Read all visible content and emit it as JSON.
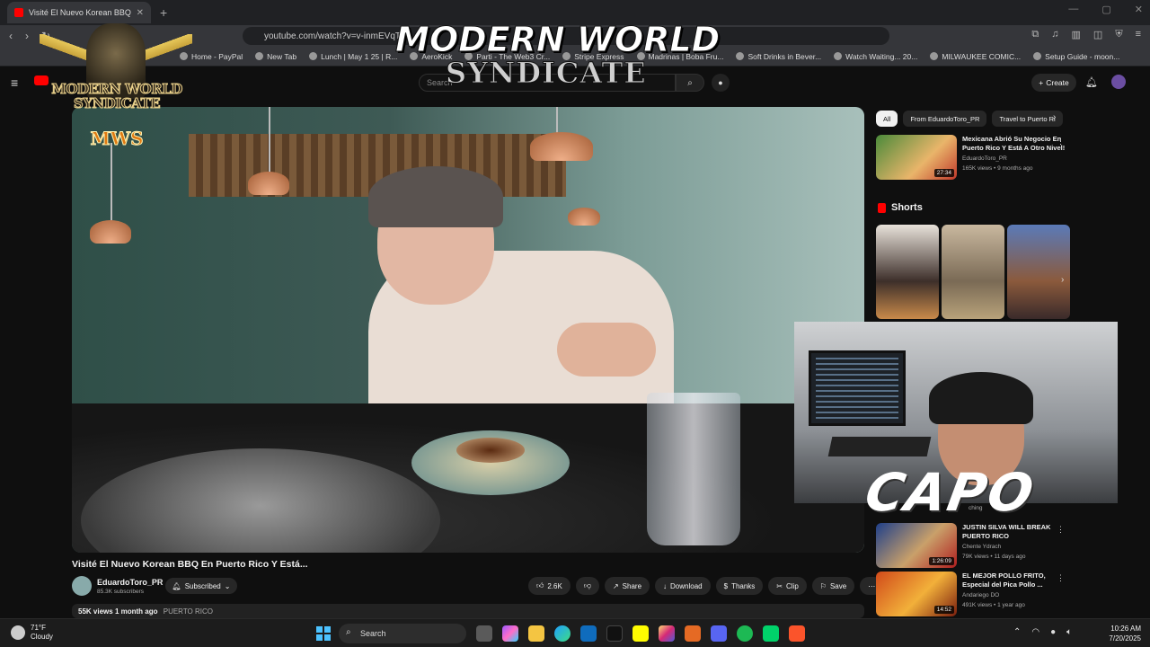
{
  "browser": {
    "tab_title": "Visité El Nuevo Korean BBQ En",
    "url": "youtube.com/watch?v=v-inmEVqTLA",
    "bookmarks": [
      "Home - PayPal",
      "New Tab",
      "Lunch | May 1 25 | R...",
      "AeroKick",
      "Parti - The Web3 Cr...",
      "Stripe Express",
      "Madrinas | Boba Fru...",
      "Soft Drinks in Bever...",
      "Watch Waiting... 20...",
      "MILWAUKEE COMIC...",
      "Setup Guide - moon..."
    ]
  },
  "youtube": {
    "search_placeholder": "Search",
    "create_label": "Create",
    "video": {
      "title": "Visité El Nuevo Korean BBQ En Puerto Rico Y Está...",
      "channel": "EduardoToro_PR",
      "subscribers": "85.3K subscribers",
      "subscribe_label": "Subscribed",
      "likes": "2.6K",
      "share_label": "Share",
      "download_label": "Download",
      "thanks_label": "Thanks",
      "clip_label": "Clip",
      "save_label": "Save",
      "views": "55K views",
      "age": "1 month ago",
      "tag": "PUERTO RICO"
    },
    "chips": [
      "All",
      "From EduardoToro_PR",
      "Travel to Puerto Ri"
    ],
    "recommendations": [
      {
        "title": "Mexicana Abrió Su Negocio En Puerto Rico Y Está A Otro Nivel!",
        "channel": "EduardoToro_PR",
        "meta": "165K views • 9 months ago",
        "duration": "27:34"
      },
      {
        "title": "JUSTIN SILVA WILL BREAK PUERTO RICO",
        "channel": "Chente Ydrach",
        "meta": "79K views • 11 days ago",
        "duration": "1:26:09"
      },
      {
        "title": "EL MEJOR POLLO FRITO, Especial del Pica Pollo ...",
        "channel": "Andariego DO",
        "meta": "491K views • 1 year ago",
        "duration": "14:52"
      }
    ],
    "shorts_label": "Shorts"
  },
  "overlay": {
    "brand_line1": "MODERN WORLD",
    "brand_line2": "SYNDICATE",
    "badge_line1": "MODERN WORLD",
    "badge_line2": "SYNDICATE",
    "badge_abbrev": "MWS",
    "webcam_label": "CAPO",
    "watching_text": "ching"
  },
  "taskbar": {
    "temperature": "71°F",
    "condition": "Cloudy",
    "search_label": "Search",
    "time": "10:26 AM",
    "date": "7/20/2025"
  },
  "colors": {
    "background": "#0f0f0f",
    "youtube_red": "#ff0000",
    "chip_bg": "#272727"
  }
}
